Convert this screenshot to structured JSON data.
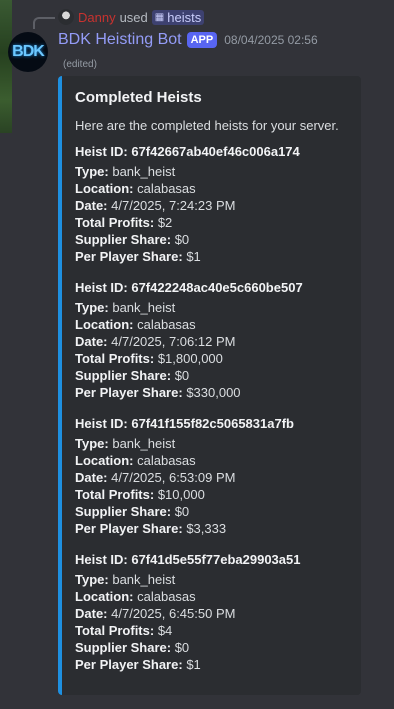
{
  "reply": {
    "user": "Danny",
    "verb": "used",
    "command": "heists"
  },
  "message": {
    "author": "BDK Heisting Bot",
    "badge": "APP",
    "timestamp": "08/04/2025 02:56",
    "edited": "(edited)",
    "avatar_text": "BDK"
  },
  "embed": {
    "accent_color": "#1e90e1",
    "title": "Completed Heists",
    "description": "Here are the completed heists for your server.",
    "labels": {
      "type": "Type:",
      "location": "Location:",
      "date": "Date:",
      "total": "Total Profits:",
      "supplier": "Supplier Share:",
      "per_player": "Per Player Share:"
    },
    "heists": [
      {
        "heading": "Heist ID: 67f42667ab40ef46c006a174",
        "type": "bank_heist",
        "location": "calabasas",
        "date": "4/7/2025, 7:24:23 PM",
        "total": "$2",
        "supplier": "$0",
        "per_player": "$1"
      },
      {
        "heading": "Heist ID: 67f422248ac40e5c660be507",
        "type": "bank_heist",
        "location": "calabasas",
        "date": "4/7/2025, 7:06:12 PM",
        "total": "$1,800,000",
        "supplier": "$0",
        "per_player": "$330,000"
      },
      {
        "heading": "Heist ID: 67f41f155f82c5065831a7fb",
        "type": "bank_heist",
        "location": "calabasas",
        "date": "4/7/2025, 6:53:09 PM",
        "total": "$10,000",
        "supplier": "$0",
        "per_player": "$3,333"
      },
      {
        "heading": "Heist ID: 67f41d5e55f77eba29903a51",
        "type": "bank_heist",
        "location": "calabasas",
        "date": "4/7/2025, 6:45:50 PM",
        "total": "$4",
        "supplier": "$0",
        "per_player": "$1"
      }
    ]
  }
}
